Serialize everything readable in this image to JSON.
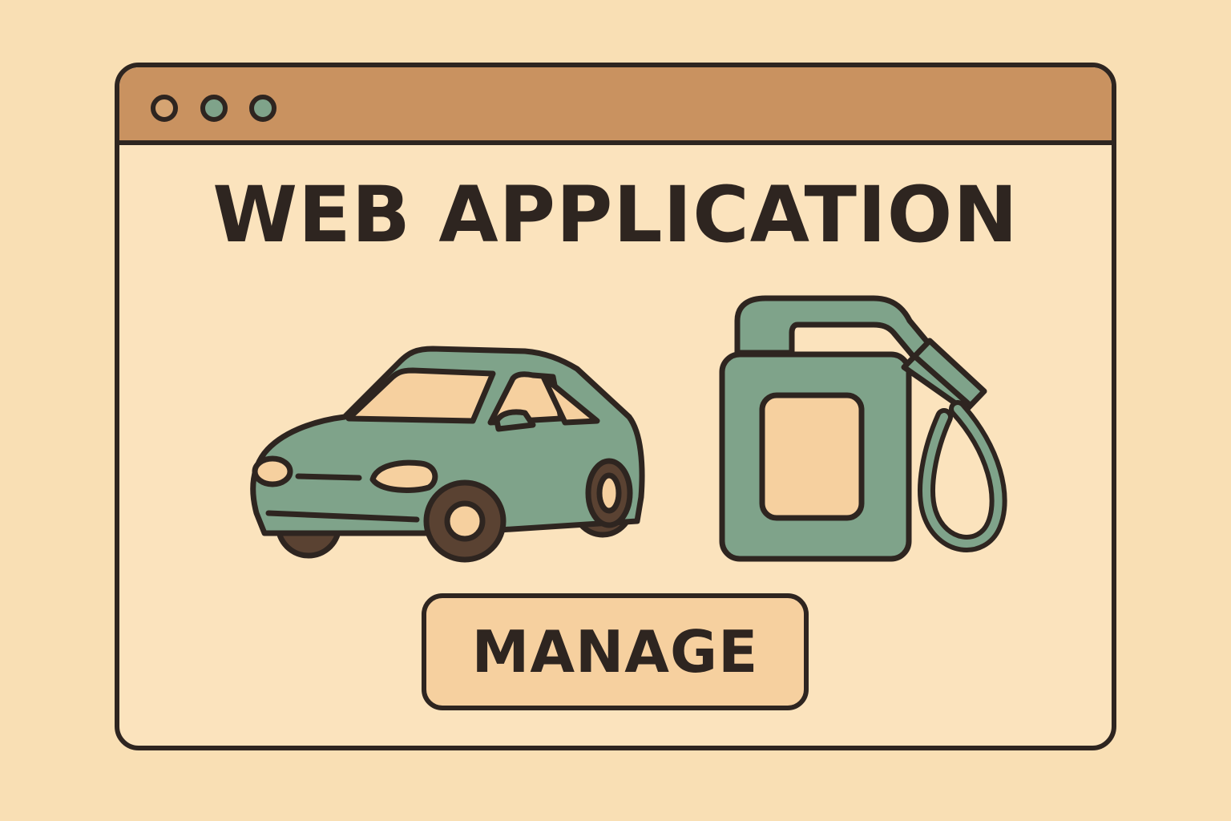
{
  "window": {
    "controls": [
      "window-control-dot",
      "window-control-dot",
      "window-control-dot"
    ]
  },
  "main": {
    "title": "WEB APPLICATION",
    "illustrations": [
      "car-icon",
      "fuel-pump-icon"
    ],
    "action_button_label": "MANAGE"
  },
  "colors": {
    "background": "#F9DFB4",
    "titlebar": "#C99260",
    "accent_green": "#7FA38A",
    "outline": "#2E2520",
    "button_fill": "#F6D09F"
  }
}
